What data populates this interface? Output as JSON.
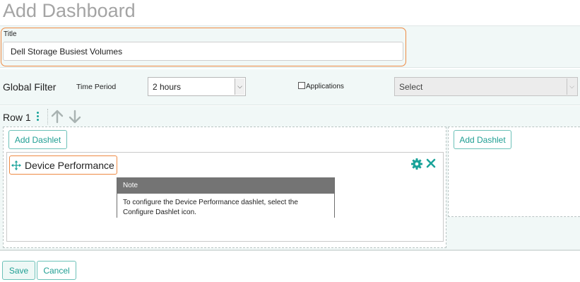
{
  "page": {
    "title": "Add Dashboard"
  },
  "title_field": {
    "label": "Title",
    "value": "Dell Storage Busiest Volumes"
  },
  "global_filter": {
    "label": "Global Filter",
    "time_period_label": "Time Period",
    "time_period_value": "2 hours",
    "applications_label": "Applications",
    "applications_checked": false,
    "select_value": "Select"
  },
  "row": {
    "label": "Row 1",
    "add_dashlet_label": "Add Dashlet",
    "add_dashlet_right_label": "Add Dashlet",
    "dashlet": {
      "title": "Device Performance",
      "note_title": "Note",
      "note_text": "To configure the Device Performance dashlet, select the Configure Dashlet icon."
    }
  },
  "footer": {
    "save_label": "Save",
    "cancel_label": "Cancel"
  },
  "colors": {
    "accent": "#1aa39a",
    "highlight": "#ee8a43",
    "panel_bg": "#f1f8f7"
  }
}
